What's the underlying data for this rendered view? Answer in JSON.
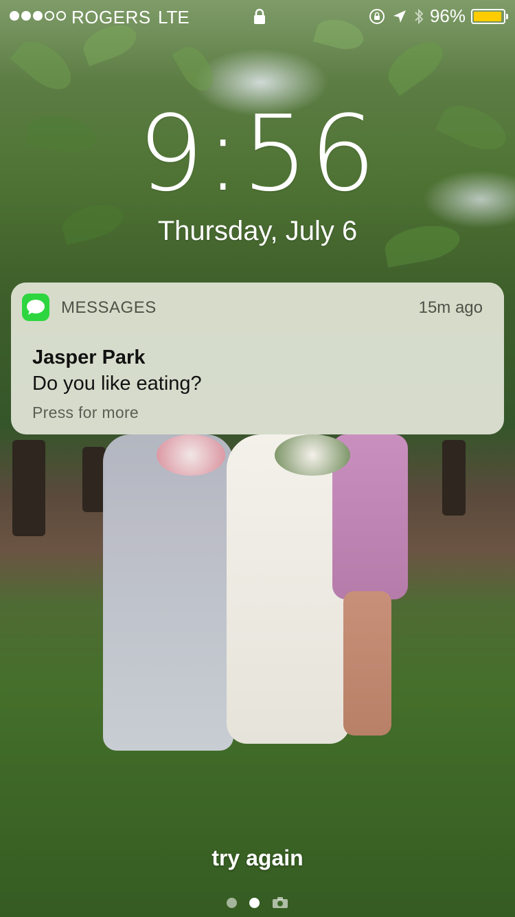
{
  "status_bar": {
    "carrier": "ROGERS",
    "network": "LTE",
    "signal_bars_filled": 3,
    "signal_bars_total": 5,
    "battery_percent_label": "96%",
    "battery_level": 0.96,
    "battery_color": "#ffcc00",
    "icons": [
      "lock-icon",
      "orientation-lock-icon",
      "location-arrow-icon",
      "bluetooth-icon"
    ]
  },
  "lock_screen": {
    "time": "9:56",
    "date": "Thursday, July 6"
  },
  "notification": {
    "app_name": "MESSAGES",
    "app_icon": "messages-icon",
    "app_icon_color": "#2dd63f",
    "time_ago": "15m ago",
    "sender": "Jasper Park",
    "message": "Do you like eating?",
    "hint": "Press for more"
  },
  "footer": {
    "unlock_hint": "try again",
    "page_indicator": {
      "pages": 2,
      "active_index": 1,
      "trailing_icon": "camera-icon"
    }
  }
}
